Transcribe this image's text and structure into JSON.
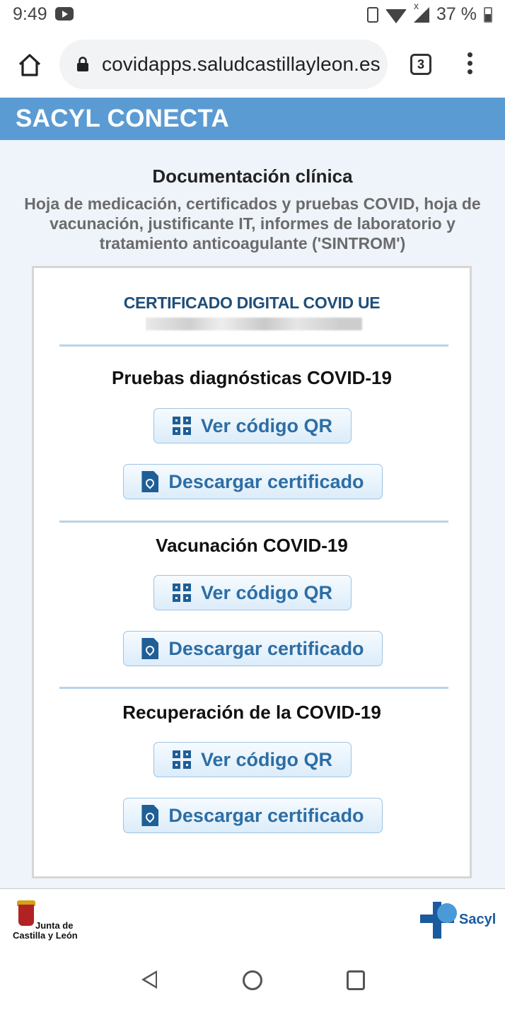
{
  "status_bar": {
    "time": "9:49",
    "battery": "37 %"
  },
  "browser": {
    "url": "covidapps.saludcastillayleon.es",
    "tab_count": "3"
  },
  "site": {
    "title": "SACYL CONECTA"
  },
  "intro": {
    "title": "Documentación clínica",
    "subtitle": "Hoja de medicación, certificados y pruebas COVID, hoja de vacunación, justificante IT, informes de laboratorio y tratamiento anticoagulante ('SINTROM')"
  },
  "card": {
    "title": "CERTIFICADO DIGITAL COVID UE",
    "sections": [
      {
        "title": "Pruebas diagnósticas COVID-19",
        "qr_label": "Ver código QR",
        "download_label": "Descargar certificado"
      },
      {
        "title": "Vacunación COVID-19",
        "qr_label": "Ver código QR",
        "download_label": "Descargar certificado"
      },
      {
        "title": "Recuperación de la COVID-19",
        "qr_label": "Ver código QR",
        "download_label": "Descargar certificado"
      }
    ]
  },
  "footer": {
    "left_logo_line1": "Junta de",
    "left_logo_line2": "Castilla y León",
    "right_logo": "Sacyl"
  },
  "colors": {
    "header_blue": "#5b9bd3",
    "button_text": "#2d6ea5",
    "title_navy": "#1f4e79"
  },
  "icons": [
    "home-icon",
    "lock-icon",
    "tabs-icon",
    "menu-icon",
    "qr-code-icon",
    "pdf-icon",
    "back-icon",
    "home-circle-icon",
    "recents-icon"
  ]
}
